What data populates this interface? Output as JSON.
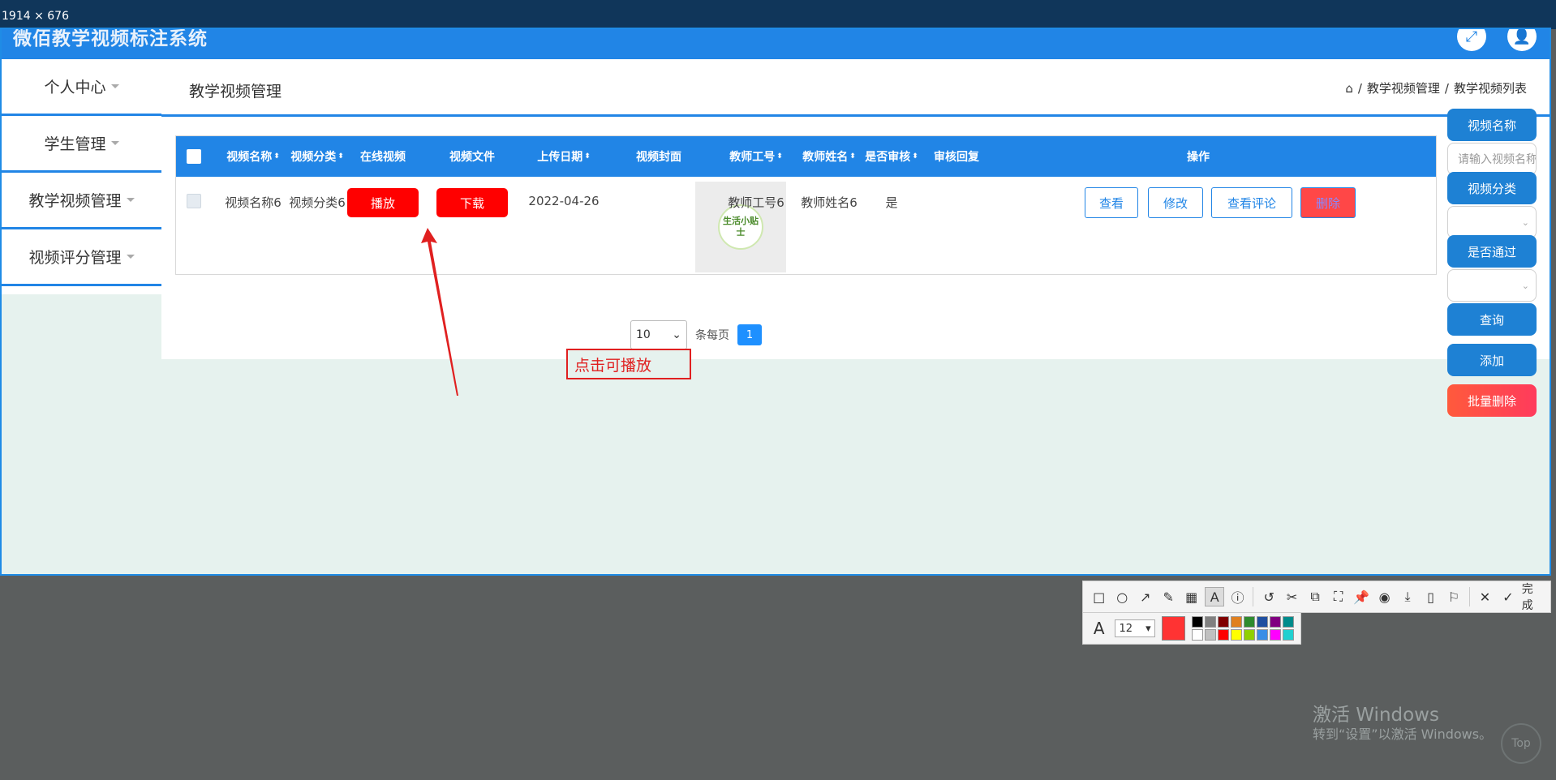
{
  "capture": {
    "dimensions": "1914 × 676"
  },
  "app": {
    "title": "微佰教学视频标注系统"
  },
  "sidebar": {
    "items": [
      {
        "label": "个人中心"
      },
      {
        "label": "学生管理"
      },
      {
        "label": "教学视频管理"
      },
      {
        "label": "视频评分管理"
      }
    ]
  },
  "main": {
    "title": "教学视频管理",
    "breadcrumb": [
      "教学视频管理",
      "教学视频列表"
    ],
    "breadcrumb_sep": "/"
  },
  "table": {
    "headers": [
      "视频名称",
      "视频分类",
      "在线视频",
      "视频文件",
      "上传日期",
      "视频封面",
      "教师工号",
      "教师姓名",
      "是否审核",
      "审核回复",
      "操作"
    ],
    "sort_icon": "⬍",
    "row": {
      "name": "视频名称6",
      "category": "视频分类6",
      "play": "播放",
      "download": "下载",
      "date": "2022-04-26",
      "cover_text": "生活小贴士",
      "teacher_id": "教师工号6",
      "teacher_name": "教师姓名6",
      "reviewed": "是",
      "reply": ""
    },
    "actions": {
      "view": "查看",
      "edit": "修改",
      "comments": "查看评论",
      "delete": "删除"
    }
  },
  "pagination": {
    "page_size": "10",
    "per_page_label": "条每页",
    "current_page": "1"
  },
  "filters": {
    "name_label": "视频名称",
    "name_placeholder": "请输入视频名称",
    "category_label": "视频分类",
    "passed_label": "是否通过",
    "query": "查询",
    "add": "添加",
    "batch_delete": "批量删除"
  },
  "annotation": {
    "text": "点击可播放",
    "color": "#e02020"
  },
  "toolbar": {
    "done": "完成",
    "font_size": "12",
    "current_color": "#ff3333"
  },
  "palette": [
    "#000000",
    "#808080",
    "#800000",
    "#e08020",
    "#2e8b2e",
    "#1f4fa0",
    "#800080",
    "#008b8b",
    "#ffffff",
    "#c0c0c0",
    "#ff0000",
    "#ffff00",
    "#90d000",
    "#3a8ee6",
    "#ff00ff",
    "#20d0d0"
  ],
  "watermark": {
    "title": "激活 Windows",
    "subtitle": "转到“设置”以激活 Windows。"
  },
  "top_button": "Top",
  "colors": {
    "primary": "#2185e6",
    "danger": "#ff0000",
    "background": "#e6f2ee"
  }
}
